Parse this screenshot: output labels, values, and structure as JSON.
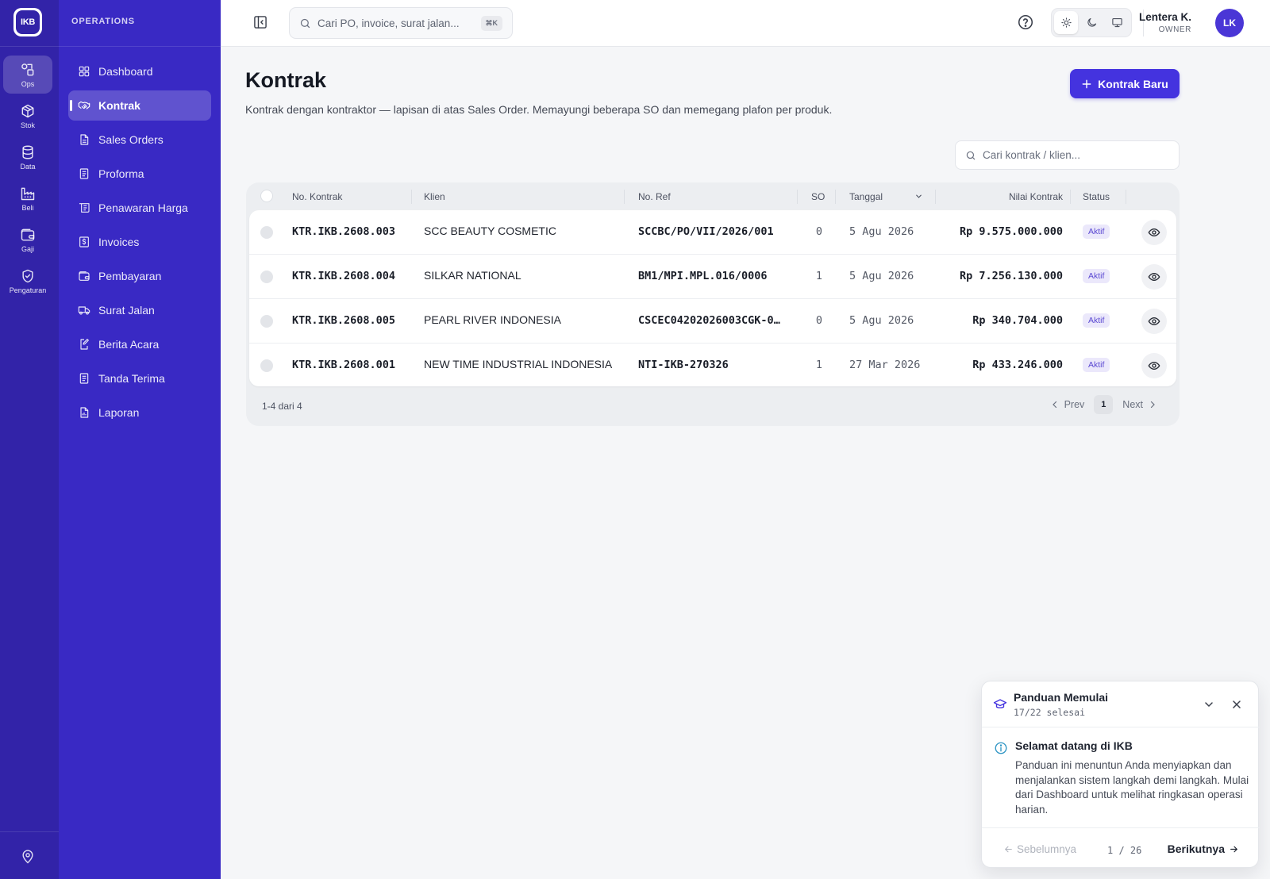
{
  "brand": {
    "logo_text": "IKB"
  },
  "rail": {
    "items": [
      {
        "label": "Ops",
        "icon": "shapes-icon",
        "active": true
      },
      {
        "label": "Stok",
        "icon": "box-icon"
      },
      {
        "label": "Data",
        "icon": "database-icon"
      },
      {
        "label": "Beli",
        "icon": "factory-icon"
      },
      {
        "label": "Gaji",
        "icon": "wallet-icon"
      },
      {
        "label": "Pengaturan",
        "icon": "shield-check-icon"
      }
    ],
    "bottom_icon": "map-pin-icon"
  },
  "sidebar": {
    "heading": "OPERATIONS",
    "items": [
      {
        "label": "Dashboard",
        "icon": "grid-icon"
      },
      {
        "label": "Kontrak",
        "icon": "handshake-icon",
        "active": true
      },
      {
        "label": "Sales Orders",
        "icon": "document-icon"
      },
      {
        "label": "Proforma",
        "icon": "document-lines-icon"
      },
      {
        "label": "Penawaran Harga",
        "icon": "receipt-icon"
      },
      {
        "label": "Invoices",
        "icon": "dollar-document-icon"
      },
      {
        "label": "Pembayaran",
        "icon": "wallet-icon"
      },
      {
        "label": "Surat Jalan",
        "icon": "truck-icon"
      },
      {
        "label": "Berita Acara",
        "icon": "edit-document-icon"
      },
      {
        "label": "Tanda Terima",
        "icon": "document-lines-icon"
      },
      {
        "label": "Laporan",
        "icon": "report-icon"
      }
    ]
  },
  "topbar": {
    "search_placeholder": "Cari PO, invoice, surat jalan...",
    "shortcut": "⌘K",
    "user_name": "Lentera K.",
    "user_role": "OWNER",
    "avatar_initials": "LK",
    "theme_active": "light"
  },
  "page": {
    "title": "Kontrak",
    "subtitle": "Kontrak dengan kontraktor — lapisan di atas Sales Order. Memayungi beberapa SO dan memegang plafon per produk.",
    "new_button": "Kontrak Baru",
    "filter_placeholder": "Cari kontrak / klien..."
  },
  "table": {
    "columns": {
      "no_kontrak": "No. Kontrak",
      "klien": "Klien",
      "no_ref": "No. Ref",
      "so": "SO",
      "tanggal": "Tanggal",
      "nilai": "Nilai Kontrak",
      "status": "Status"
    },
    "rows": [
      {
        "no_kontrak": "KTR.IKB.2608.003",
        "klien": "SCC BEAUTY COSMETIC",
        "no_ref": "SCCBC/PO/VII/2026/001",
        "so": "0",
        "tanggal": "5 Agu 2026",
        "nilai": "Rp 9.575.000.000",
        "status": "Aktif"
      },
      {
        "no_kontrak": "KTR.IKB.2608.004",
        "klien": "SILKAR NATIONAL",
        "no_ref": "BM1/MPI.MPL.016/0006",
        "so": "1",
        "tanggal": "5 Agu 2026",
        "nilai": "Rp 7.256.130.000",
        "status": "Aktif"
      },
      {
        "no_kontrak": "KTR.IKB.2608.005",
        "klien": "PEARL RIVER INDONESIA",
        "no_ref": "CSCEC04202026003CGK-0...",
        "so": "0",
        "tanggal": "5 Agu 2026",
        "nilai": "Rp 340.704.000",
        "status": "Aktif"
      },
      {
        "no_kontrak": "KTR.IKB.2608.001",
        "klien": "NEW TIME INDUSTRIAL INDONESIA",
        "no_ref": "NTI-IKB-270326",
        "so": "1",
        "tanggal": "27 Mar 2026",
        "nilai": "Rp 433.246.000",
        "status": "Aktif"
      }
    ],
    "footer_count": "1-4 dari 4",
    "pager": {
      "prev": "Prev",
      "current": "1",
      "next": "Next"
    }
  },
  "guide": {
    "title": "Panduan Memulai",
    "progress": "17/22 selesai",
    "step_title": "Selamat datang di IKB",
    "step_body": "Panduan ini menuntun Anda menyiapkan dan menjalankan sistem langkah demi langkah. Mulai dari Dashboard untuk melihat ringkasan operasi harian.",
    "prev": "Sebelumnya",
    "counter": "1 / 26",
    "next": "Berikutnya"
  },
  "colors": {
    "rail": "#3223a8",
    "sidebar": "#3929c4",
    "accent": "#4433df",
    "badge_bg": "#ebe8fb",
    "badge_text": "#5a48d2"
  }
}
